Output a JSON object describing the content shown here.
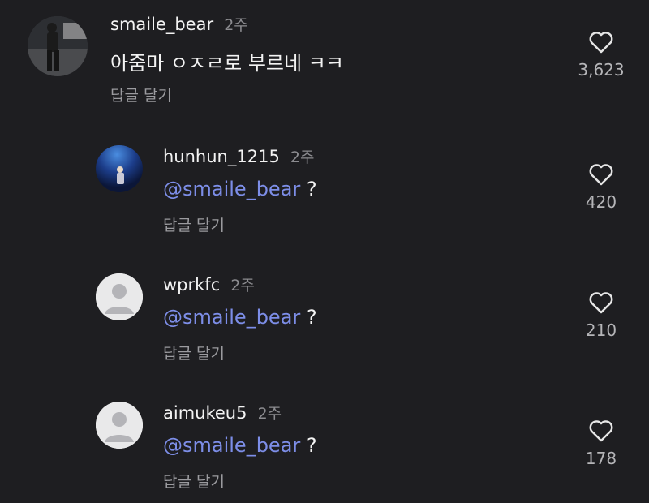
{
  "comments": [
    {
      "username": "smaile_bear",
      "time": "2주",
      "text": "아줌마 ㅇㅈㄹ로 부르네 ㅋㅋ",
      "reply_label": "답글 달기",
      "likes": "3,623",
      "avatar": "photo-person-icon"
    }
  ],
  "replies": [
    {
      "username": "hunhun_1215",
      "time": "2주",
      "mention": "@smaile_bear",
      "suffix": "?",
      "reply_label": "답글 달기",
      "likes": "420",
      "avatar": "photo-blue-icon"
    },
    {
      "username": "wprkfc",
      "time": "2주",
      "mention": "@smaile_bear",
      "suffix": "?",
      "reply_label": "답글 달기",
      "likes": "210",
      "avatar": "default-user-icon"
    },
    {
      "username": "aimukeu5",
      "time": "2주",
      "mention": "@smaile_bear",
      "suffix": "?",
      "reply_label": "답글 달기",
      "likes": "178",
      "avatar": "default-user-icon"
    }
  ],
  "colors": {
    "background": "#1e1e21",
    "mention": "#7d8ee8",
    "muted": "#8c8c90"
  }
}
